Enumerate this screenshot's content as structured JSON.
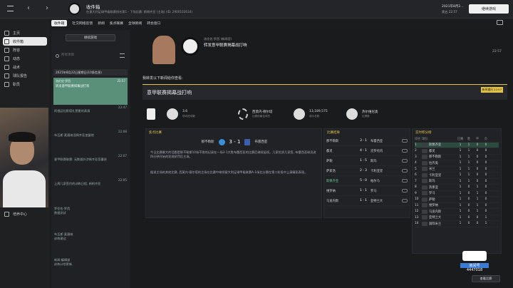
{
  "topbar": {
    "title": "收件箱",
    "subtitle": "在意大利足球甲级联赛排名第1 - 下场比赛: 斯佩齐亚 (主场) (ID: 2900102634)",
    "date": "2021年8月2...",
    "weekday": "周五 22:57",
    "continue_label": "继续游戏"
  },
  "tabs": [
    "收件箱",
    "社交网络反馈",
    "新闻",
    "焦点联赛",
    "全球新闻",
    "转会窗口"
  ],
  "sidebar": {
    "items": [
      "主页",
      "收件箱",
      "阵容",
      "动态",
      "战术",
      "球队报告",
      "职员"
    ],
    "footer": "培养中心"
  },
  "inbox": {
    "continue_label": "继续游戏",
    "filter": "所有项目",
    "group_header": "2021年8月22日星期日(10条信息)",
    "messages": [
      {
        "from": "洛伦佐·罗西",
        "time": "22:57",
        "title": "转发意甲联赛揭幕战打响"
      },
      {
        "from": "新闻",
        "time": "22:47",
        "title": "阿根廷拉默德礼赞夏的表演"
      },
      {
        "from": "",
        "time": "22:08",
        "title": "布瓦斯·麦唐纳涅佩齐亚加盟他"
      },
      {
        "from": "",
        "time": "22:07",
        "title": "意甲联赛联赛: 无数据外涉佩齐亚签署进"
      },
      {
        "from": "",
        "time": "22:05",
        "title": "上周几家签约的训练日程, 新帆齐亚"
      },
      {
        "from": "罗伦佐·罗西",
        "time": "",
        "title": "数据测试"
      },
      {
        "from": "布瓦斯·麦唐纳",
        "time": "",
        "title": "训练建议"
      },
      {
        "from": "新闻·编辑部",
        "time": "",
        "title": "训练计划更新"
      }
    ]
  },
  "message": {
    "from": "洛伦佐·罗西 (新闻官)",
    "subject": "转发意甲联赛揭幕战打响",
    "time": "22:57",
    "intro": "我转发以下新闻给你查看:",
    "headline": "意甲联赛揭幕战打响",
    "news_tag": "新闻通讯 22:57",
    "stats": [
      {
        "label": "3.6",
        "sub": "场均进球数"
      },
      {
        "label": "西莫内·德尔塔",
        "sub": "比赛的最佳球员"
      },
      {
        "label": "13,189,575",
        "sub": "观众总数"
      },
      {
        "label": "热尔维尼奥",
        "sub": "红牌数"
      }
    ],
    "focus_title": "焦点比赛",
    "focus_home": "那不勒斯",
    "focus_away": "布雷西亚",
    "focus_score": "3 - 1",
    "body1": "今日比赛最大的话题是那不勒斯10场不败的记录在一场3-1大胜布雷西亚的比赛后继续延续。几家优质几家签, 布雷西亚球员进四分钟开始的犯规惩罚后主场。",
    "body2": "据说主场的其他比赛, 西莫内·德尔塔的主场在比赛中带领意大利足球甲级联赛A-1场比分赛在第二阶段中上演精彩表现。",
    "results_title": "比赛结果",
    "results": [
      {
        "home": "那不勒斯",
        "score": "3 - 1",
        "away": "布雷西亚"
      },
      {
        "home": "都灵",
        "score": "4 - 1",
        "away": "克罗托内"
      },
      {
        "home": "萨勒",
        "score": "1 - 5",
        "away": "斯玛"
      },
      {
        "home": "萨索洛",
        "score": "2 - 3",
        "away": "卡利亚里"
      },
      {
        "home": "斯佩齐亚",
        "score": "5 - 0",
        "away": "帕尔马"
      },
      {
        "home": "维罗纳",
        "score": "1 - 1",
        "away": "罗马"
      },
      {
        "home": "乌迪内斯",
        "score": "1 - 1",
        "away": "亚特兰大"
      }
    ],
    "table_title": "实时积分榜",
    "table_headers": [
      "排名",
      "球队",
      "已赛",
      "胜",
      "平",
      "负"
    ],
    "table": [
      {
        "pos": "1",
        "team": "斯佩齐亚",
        "p": "1",
        "w": "1",
        "d": "0",
        "l": "0"
      },
      {
        "pos": "2",
        "team": "都灵",
        "p": "1",
        "w": "1",
        "d": "0",
        "l": "0"
      },
      {
        "pos": "3",
        "team": "那不勒斯",
        "p": "1",
        "w": "1",
        "d": "0",
        "l": "0"
      },
      {
        "pos": "4",
        "team": "拉齐奥",
        "p": "1",
        "w": "1",
        "d": "0",
        "l": "0"
      },
      {
        "pos": "5",
        "team": "米兰",
        "p": "1",
        "w": "1",
        "d": "0",
        "l": "0"
      },
      {
        "pos": "6",
        "team": "卡利亚里",
        "p": "1",
        "w": "1",
        "d": "0",
        "l": "0"
      },
      {
        "pos": "7",
        "team": "斯玛",
        "p": "1",
        "w": "1",
        "d": "0",
        "l": "0"
      },
      {
        "pos": "8",
        "team": "热那亚",
        "p": "1",
        "w": "0",
        "d": "1",
        "l": "0"
      },
      {
        "pos": "9",
        "team": "罗马",
        "p": "1",
        "w": "0",
        "d": "1",
        "l": "0"
      },
      {
        "pos": "10",
        "team": "萨勒",
        "p": "1",
        "w": "0",
        "d": "1",
        "l": "0"
      },
      {
        "pos": "11",
        "team": "维罗纳",
        "p": "1",
        "w": "0",
        "d": "1",
        "l": "0"
      },
      {
        "pos": "12",
        "team": "乌迪内斯",
        "p": "1",
        "w": "0",
        "d": "1",
        "l": "0"
      },
      {
        "pos": "13",
        "team": "亚特兰大",
        "p": "1",
        "w": "0",
        "d": "0",
        "l": "1"
      },
      {
        "pos": "14",
        "team": "国际米兰",
        "p": "1",
        "w": "0",
        "d": "0",
        "l": "1"
      }
    ],
    "view_label": "查看比赛"
  },
  "overlay": {
    "room": "房间号",
    "number": "4447018"
  },
  "colors": {
    "accent": "#e4c34a",
    "selected": "#5a8f7a",
    "green": "#67c79a"
  }
}
